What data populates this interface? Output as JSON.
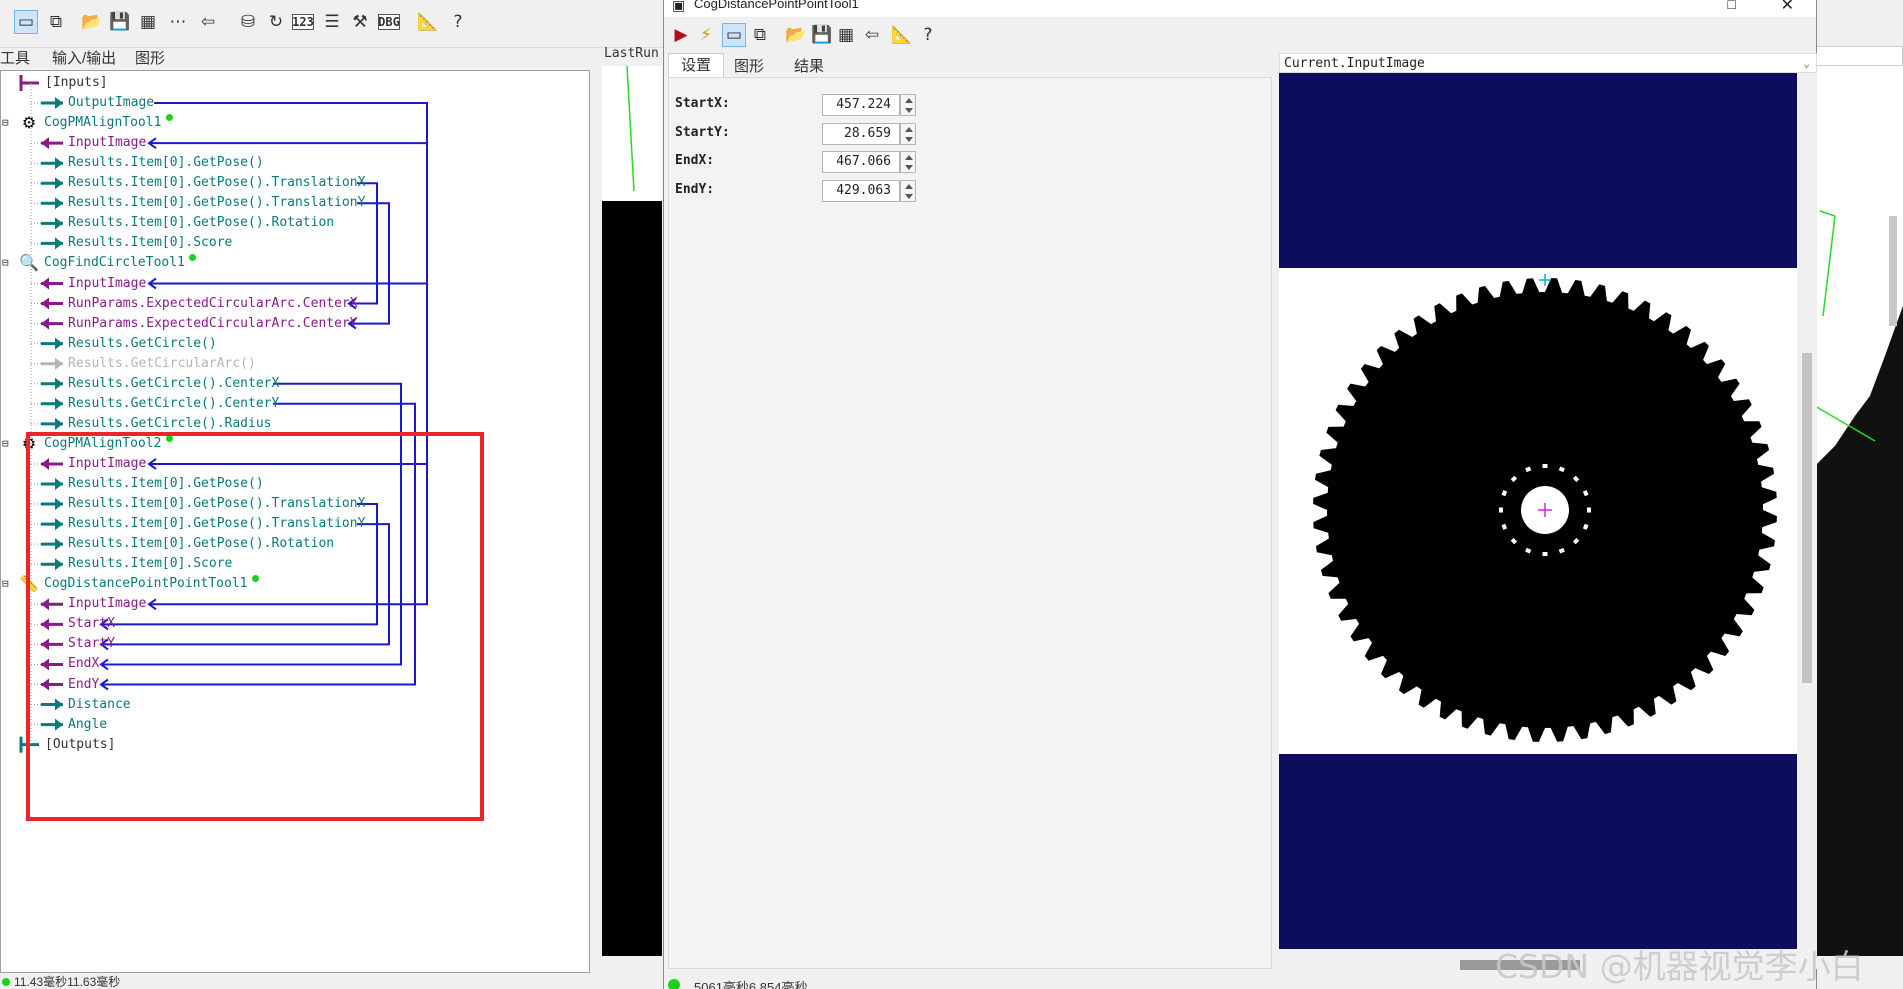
{
  "left_window": {
    "tabs": [
      "工具",
      "输入/输出",
      "图形"
    ],
    "status": "11.43毫秒11.63毫秒",
    "tree": [
      {
        "label": "[Inputs]",
        "kind": "plain"
      },
      {
        "label": "OutputImage",
        "kind": "output"
      },
      {
        "label": "CogPMAlignTool1",
        "kind": "tool"
      },
      {
        "label": "InputImage",
        "kind": "input"
      },
      {
        "label": "Results.Item[0].GetPose()",
        "kind": "output"
      },
      {
        "label": "Results.Item[0].GetPose().TranslationX",
        "kind": "output"
      },
      {
        "label": "Results.Item[0].GetPose().TranslationY",
        "kind": "output"
      },
      {
        "label": "Results.Item[0].GetPose().Rotation",
        "kind": "output"
      },
      {
        "label": "Results.Item[0].Score",
        "kind": "output"
      },
      {
        "label": "CogFindCircleTool1",
        "kind": "tool"
      },
      {
        "label": "InputImage",
        "kind": "input"
      },
      {
        "label": "RunParams.ExpectedCircularArc.CenterX",
        "kind": "input"
      },
      {
        "label": "RunParams.ExpectedCircularArc.CenterY",
        "kind": "input"
      },
      {
        "label": "Results.GetCircle()",
        "kind": "output"
      },
      {
        "label": "Results.GetCircularArc()",
        "kind": "grey"
      },
      {
        "label": "Results.GetCircle().CenterX",
        "kind": "output"
      },
      {
        "label": "Results.GetCircle().CenterY",
        "kind": "output"
      },
      {
        "label": "Results.GetCircle().Radius",
        "kind": "output"
      },
      {
        "label": "CogPMAlignTool2",
        "kind": "tool"
      },
      {
        "label": "InputImage",
        "kind": "input"
      },
      {
        "label": "Results.Item[0].GetPose()",
        "kind": "output"
      },
      {
        "label": "Results.Item[0].GetPose().TranslationX",
        "kind": "output"
      },
      {
        "label": "Results.Item[0].GetPose().TranslationY",
        "kind": "output"
      },
      {
        "label": "Results.Item[0].GetPose().Rotation",
        "kind": "output"
      },
      {
        "label": "Results.Item[0].Score",
        "kind": "output"
      },
      {
        "label": "CogDistancePointPointTool1",
        "kind": "tool"
      },
      {
        "label": "InputImage",
        "kind": "input"
      },
      {
        "label": "StartX",
        "kind": "input"
      },
      {
        "label": "StartY",
        "kind": "input"
      },
      {
        "label": "EndX",
        "kind": "input"
      },
      {
        "label": "EndY",
        "kind": "input"
      },
      {
        "label": "Distance",
        "kind": "output"
      },
      {
        "label": "Angle",
        "kind": "output"
      },
      {
        "label": "[Outputs]",
        "kind": "plain"
      }
    ]
  },
  "middle_panel": {
    "label": "LastRun"
  },
  "dialog": {
    "title": "CogDistancePointPointTool1",
    "tabs": [
      "设置",
      "图形",
      "结果"
    ],
    "params": [
      {
        "label": "StartX:",
        "value": "457.224"
      },
      {
        "label": "StartY:",
        "value": "28.659"
      },
      {
        "label": "EndX:",
        "value": "467.066"
      },
      {
        "label": "EndY:",
        "value": "429.063"
      }
    ],
    "image_selector": "Current.InputImage",
    "status": "5061毫秒6.854毫秒"
  },
  "watermark": "CSDN @机器视觉李小白",
  "colors": {
    "link_line": "#1a1acc",
    "highlight_box": "#e8272b",
    "image_band": "#0d0d5e",
    "gear": "#000000",
    "center_mark": "#e020e0"
  }
}
